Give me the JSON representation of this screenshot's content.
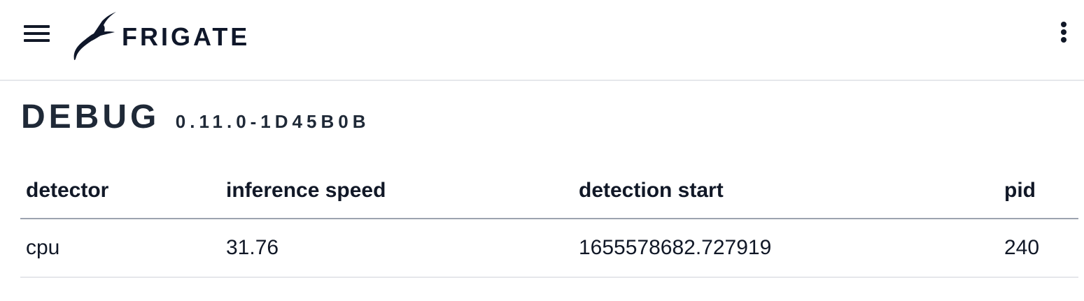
{
  "header": {
    "brand": "FRIGATE",
    "menu_icon": "hamburger-menu-icon",
    "logo_icon": "frigate-bird-logo",
    "more_icon": "more-vertical-icon"
  },
  "page": {
    "title": "DEBUG",
    "version": "0.11.0-1D45B0B"
  },
  "table": {
    "headers": [
      "detector",
      "inference speed",
      "detection start",
      "pid"
    ],
    "rows": [
      [
        "cpu",
        "31.76",
        "1655578682.727919",
        "240"
      ]
    ]
  },
  "colors": {
    "text": "#111827",
    "divider": "#e5e7eb",
    "header_border": "#9ca3af",
    "background": "#ffffff"
  }
}
